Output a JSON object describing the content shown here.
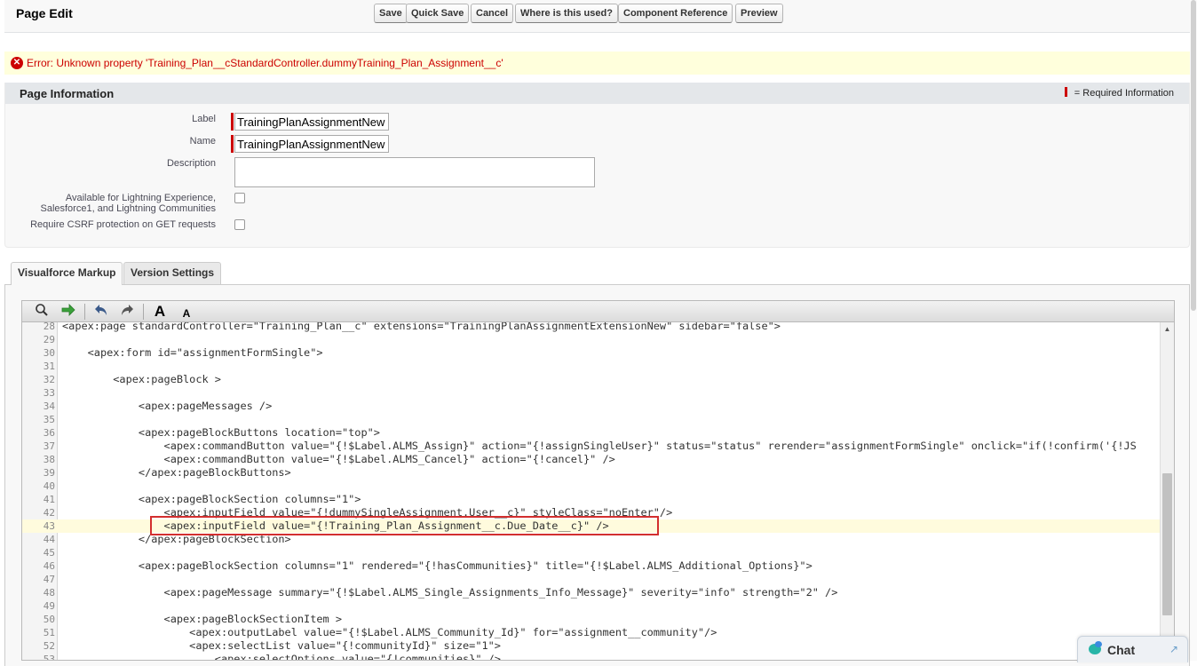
{
  "header": {
    "title": "Page Edit",
    "buttons": {
      "save": "Save",
      "quick_save": "Quick Save",
      "cancel": "Cancel",
      "where_used": "Where is this used?",
      "component_reference": "Component Reference",
      "preview": "Preview"
    }
  },
  "error": {
    "message": "Error: Unknown property 'Training_Plan__cStandardController.dummyTraining_Plan_Assignment__c'",
    "icon": "error-circle-icon",
    "color": "#cc0000"
  },
  "page_information": {
    "title": "Page Information",
    "required_legend": "= Required Information",
    "fields": {
      "label_label": "Label",
      "label_value": "TrainingPlanAssignmentNew",
      "name_label": "Name",
      "name_value": "TrainingPlanAssignmentNew",
      "description_label": "Description",
      "description_value": "",
      "lightning_label_line1": "Available for Lightning Experience,",
      "lightning_label_line2": "Salesforce1, and Lightning Communities",
      "csrf_label": "Require CSRF protection on GET requests"
    }
  },
  "tabs": {
    "visualforce_markup": "Visualforce Markup",
    "version_settings": "Version Settings"
  },
  "toolbar": {
    "search_icon": "search-icon",
    "goto_icon": "goto-arrow-icon",
    "undo_icon": "undo-icon",
    "redo_icon": "redo-icon",
    "font_larger": "A",
    "font_smaller": "A"
  },
  "code": {
    "lines": [
      {
        "n": "28",
        "text": "<apex:page standardController=\"Training_Plan__c\" extensions=\"TrainingPlanAssignmentExtensionNew\" sidebar=\"false\">"
      },
      {
        "n": "29",
        "text": ""
      },
      {
        "n": "30",
        "text": "    <apex:form id=\"assignmentFormSingle\">"
      },
      {
        "n": "31",
        "text": ""
      },
      {
        "n": "32",
        "text": "        <apex:pageBlock >"
      },
      {
        "n": "33",
        "text": ""
      },
      {
        "n": "34",
        "text": "            <apex:pageMessages />"
      },
      {
        "n": "35",
        "text": ""
      },
      {
        "n": "36",
        "text": "            <apex:pageBlockButtons location=\"top\">"
      },
      {
        "n": "37",
        "text": "                <apex:commandButton value=\"{!$Label.ALMS_Assign}\" action=\"{!assignSingleUser}\" status=\"status\" rerender=\"assignmentFormSingle\" onclick=\"if(!confirm('{!JS"
      },
      {
        "n": "38",
        "text": "                <apex:commandButton value=\"{!$Label.ALMS_Cancel}\" action=\"{!cancel}\" />"
      },
      {
        "n": "39",
        "text": "            </apex:pageBlockButtons>"
      },
      {
        "n": "40",
        "text": ""
      },
      {
        "n": "41",
        "text": "            <apex:pageBlockSection columns=\"1\">"
      },
      {
        "n": "42",
        "text": "                <apex:inputField value=\"{!dummySingleAssignment.User__c}\" styleClass=\"noEnter\"/>"
      },
      {
        "n": "43",
        "text": "                <apex:inputField value=\"{!Training_Plan_Assignment__c.Due_Date__c}\" />"
      },
      {
        "n": "44",
        "text": "            </apex:pageBlockSection>"
      },
      {
        "n": "45",
        "text": ""
      },
      {
        "n": "46",
        "text": "            <apex:pageBlockSection columns=\"1\" rendered=\"{!hasCommunities}\" title=\"{!$Label.ALMS_Additional_Options}\">"
      },
      {
        "n": "47",
        "text": ""
      },
      {
        "n": "48",
        "text": "                <apex:pageMessage summary=\"{!$Label.ALMS_Single_Assignments_Info_Message}\" severity=\"info\" strength=\"2\" />"
      },
      {
        "n": "49",
        "text": ""
      },
      {
        "n": "50",
        "text": "                <apex:pageBlockSectionItem >"
      },
      {
        "n": "51",
        "text": "                    <apex:outputLabel value=\"{!$Label.ALMS_Community_Id}\" for=\"assignment__community\"/>"
      },
      {
        "n": "52",
        "text": "                    <apex:selectList value=\"{!communityId}\" size=\"1\">"
      },
      {
        "n": "53",
        "text": "                        <apex:selectOptions value=\"{!communities}\" />"
      }
    ]
  },
  "chat": {
    "label": "Chat",
    "icon": "chat-bubbles-icon",
    "expand_icon": "expand-arrow-icon"
  }
}
